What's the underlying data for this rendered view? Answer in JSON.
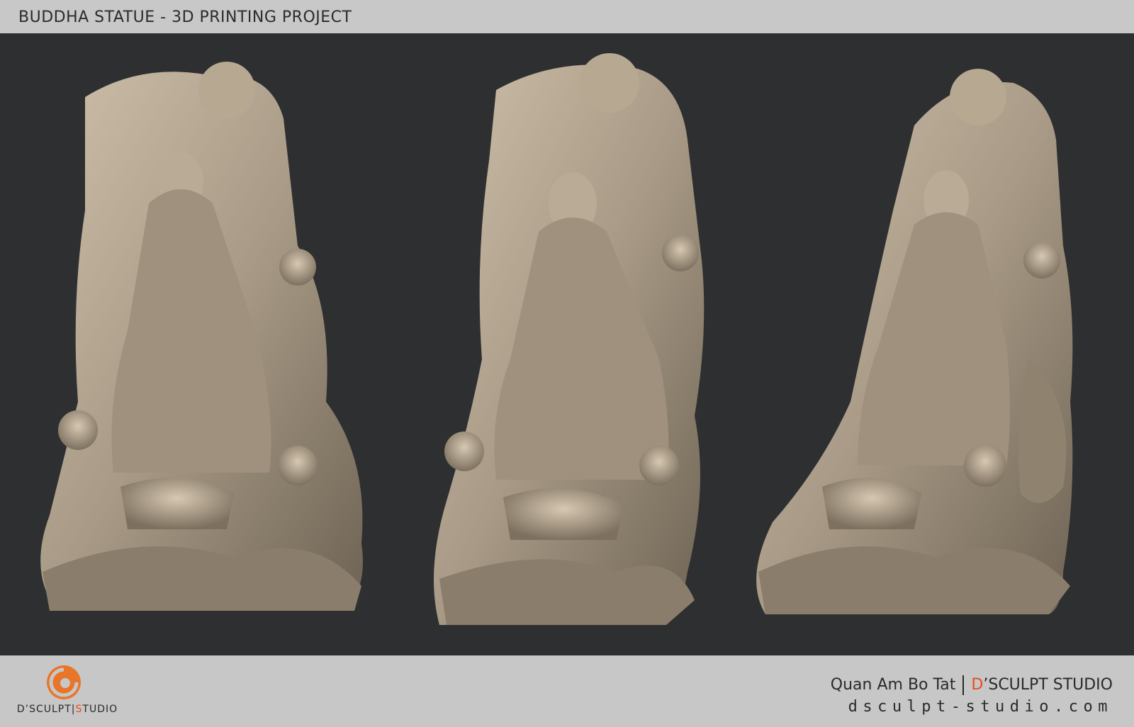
{
  "header": {
    "title": "BUDDHA STATUE - 3D PRINTING PROJECT"
  },
  "footer": {
    "logo": {
      "brand_prefix": "D",
      "brand_main": "’SCULPT",
      "brand_sep": "|",
      "brand_sub_initial": "S",
      "brand_sub_rest": "TUDIO",
      "mark_color": "#e8762a"
    },
    "statue_name": "Quan Am Bo Tat",
    "studio_prefix": "D",
    "studio_rest": "’SCULPT STUDIO",
    "website": "dsculpt-studio.com"
  },
  "colors": {
    "background": "#2e2f31",
    "bars": "#c7c7c7",
    "accent": "#e84e1b",
    "statue": "#a89a86"
  },
  "views": [
    {
      "name": "front-left-view"
    },
    {
      "name": "front-view"
    },
    {
      "name": "right-view"
    }
  ]
}
